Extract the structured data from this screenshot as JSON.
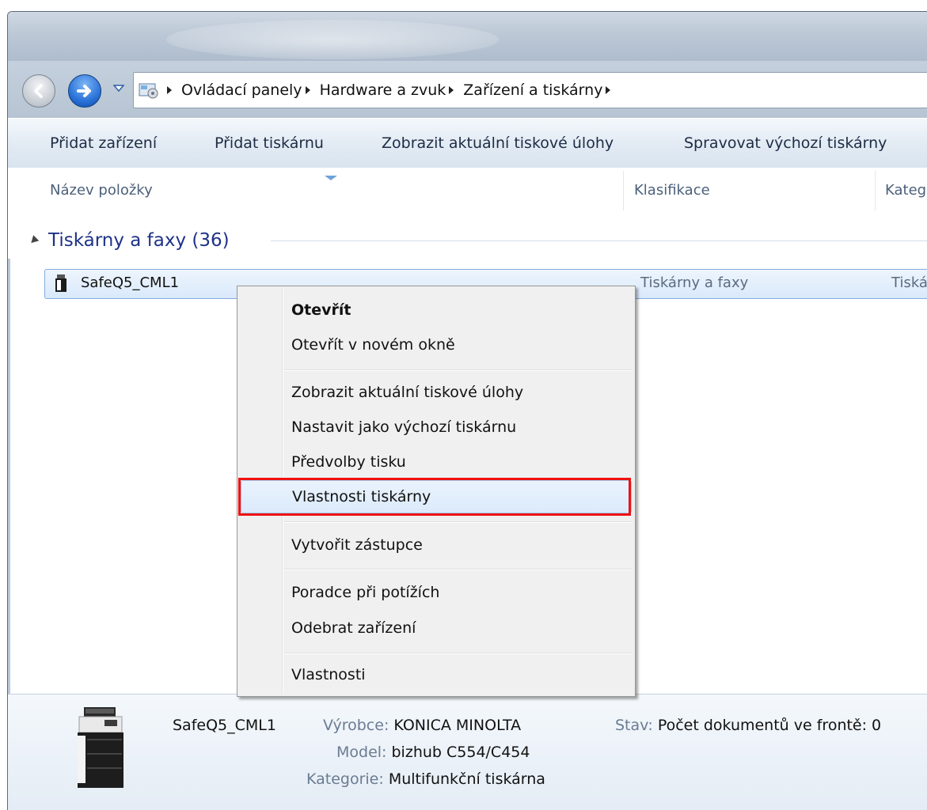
{
  "breadcrumb": [
    "Ovládací panely",
    "Hardware a zvuk",
    "Zařízení a tiskárny"
  ],
  "toolbar": {
    "add_device": "Přidat zařízení",
    "add_printer": "Přidat tiskárnu",
    "see_print_jobs": "Zobrazit aktuální tiskové úlohy",
    "manage_default": "Spravovat výchozí tiskárny"
  },
  "columns": {
    "name": "Název položky",
    "classification": "Klasifikace",
    "category": "Kateg"
  },
  "group": {
    "label": "Tiskárny a faxy (36)"
  },
  "printer_row": {
    "name": "SafeQ5_CML1",
    "classification": "Tiskárny a faxy",
    "category": "Tiská"
  },
  "context_menu": [
    "Otevřít",
    "Otevřít v novém okně",
    "Zobrazit aktuální tiskové úlohy",
    "Nastavit jako výchozí tiskárnu",
    "Předvolby tisku",
    "Vlastnosti tiskárny",
    "Vytvořit zástupce",
    "Poradce při potížích",
    "Odebrat zařízení",
    "Vlastnosti"
  ],
  "details": {
    "name": "SafeQ5_CML1",
    "manufacturer_label": "Výrobce:",
    "manufacturer": "KONICA MINOLTA",
    "model_label": "Model:",
    "model": "bizhub C554/C454",
    "category_label": "Kategorie:",
    "category": "Multifunkční tiskárna",
    "status_label": "Stav:",
    "status": "Počet dokumentů ve frontě: 0"
  },
  "colors": {
    "highlight_outline": "#ee1111",
    "group_header": "#1e3287",
    "toolbar_text": "#1c2c44"
  },
  "icons": {
    "back": "back-arrow-icon",
    "forward": "forward-arrow-icon",
    "control_panel": "control-panel-icon",
    "printer": "printer-icon"
  }
}
